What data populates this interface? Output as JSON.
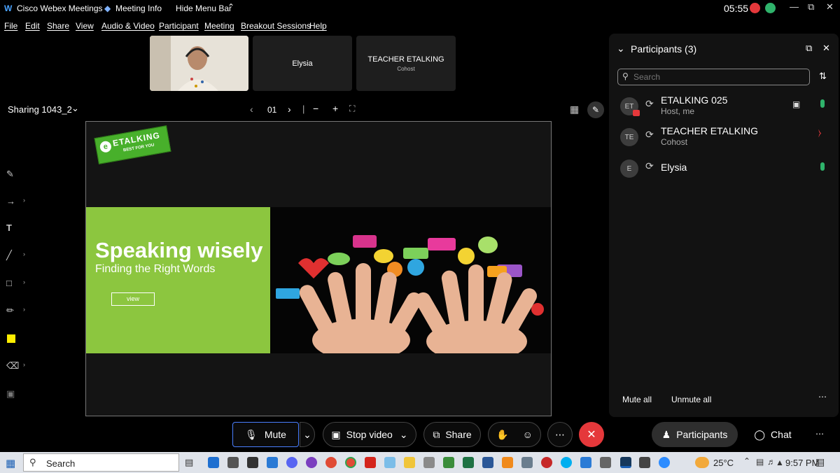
{
  "titlebar": {
    "app_title": "Cisco Webex Meetings",
    "meeting_info": "Meeting Info",
    "hide_menu": "Hide Menu Bar",
    "timer": "05:55"
  },
  "menu": [
    "File",
    "Edit",
    "Share",
    "View",
    "Audio & Video",
    "Participant",
    "Meeting",
    "Breakout Sessions",
    "Help"
  ],
  "tiles": [
    {
      "name": "",
      "sub": ""
    },
    {
      "name": "Elysia",
      "sub": ""
    },
    {
      "name": "TEACHER ETALKING",
      "sub": "Cohost"
    }
  ],
  "sharing": {
    "label": "Sharing 1043_2",
    "page": "01"
  },
  "slide": {
    "logo_text": "ETALKING",
    "logo_tagline": "BEST FOR YOU",
    "heading": "Speaking wisely",
    "subheading": "Finding the Right Words",
    "view_button": "view"
  },
  "panel": {
    "title": "Participants (3)",
    "search_placeholder": "Search",
    "participants": [
      {
        "initials": "ET",
        "name": "ETALKING 025",
        "role": "Host, me",
        "mic": "on"
      },
      {
        "initials": "TE",
        "name": "TEACHER ETALKING",
        "role": "Cohost",
        "mic": "muted"
      },
      {
        "initials": "E",
        "name": "Elysia",
        "role": "",
        "mic": "on"
      }
    ],
    "mute_all": "Mute all",
    "unmute_all": "Unmute all"
  },
  "controls": {
    "mute": "Mute",
    "stop_video": "Stop video",
    "share": "Share",
    "participants": "Participants",
    "chat": "Chat"
  },
  "taskbar": {
    "search": "Search",
    "temperature": "25°C",
    "time": "9:57 PM"
  },
  "colors": {
    "slide_green": "#8cc63f",
    "end_call": "#e5383b",
    "mic_on": "#2fb36b",
    "mic_muted": "#e5383b",
    "timer_badge": "#e5383b"
  }
}
